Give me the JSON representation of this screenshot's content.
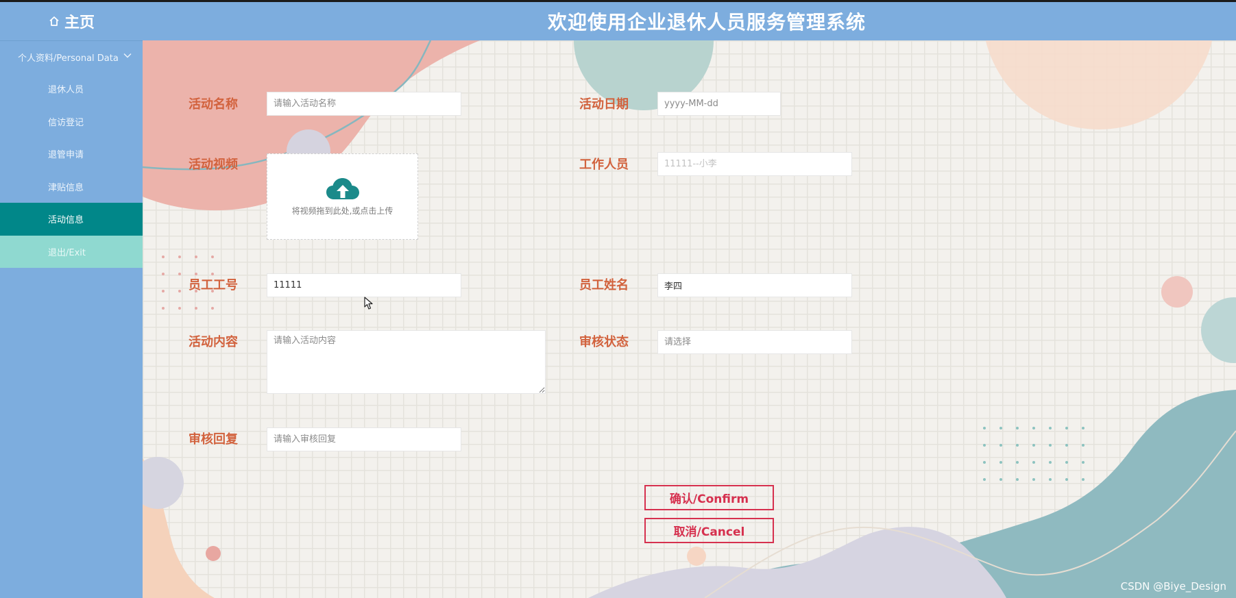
{
  "header": {
    "home_label": "主页",
    "title": "欢迎使用企业退休人员服务管理系统"
  },
  "sidebar": {
    "group_label": "个人资料/Personal Data",
    "items": [
      {
        "label": "退休人员"
      },
      {
        "label": "信访登记"
      },
      {
        "label": "退管申请"
      },
      {
        "label": "津贴信息"
      },
      {
        "label": "活动信息"
      }
    ],
    "exit_label": "退出/Exit",
    "active_item": "活动信息"
  },
  "form": {
    "activity_name": {
      "label": "活动名称",
      "value": "",
      "placeholder": "请输入活动名称"
    },
    "activity_date": {
      "label": "活动日期",
      "value": "",
      "placeholder": "yyyy-MM-dd"
    },
    "activity_video": {
      "label": "活动视频",
      "upload_text": "将视频拖到此处,或点击上传"
    },
    "staff": {
      "label": "工作人员",
      "value": "",
      "placeholder": "11111--小李"
    },
    "employee_id": {
      "label": "员工工号",
      "value": "11111",
      "placeholder": ""
    },
    "employee_name": {
      "label": "员工姓名",
      "value": "李四",
      "placeholder": ""
    },
    "activity_content": {
      "label": "活动内容",
      "value": "",
      "placeholder": "请输入活动内容"
    },
    "review_status": {
      "label": "审核状态",
      "value": "",
      "placeholder": "请选择"
    },
    "review_reply": {
      "label": "审核回复",
      "value": "",
      "placeholder": "请输入审核回复"
    }
  },
  "buttons": {
    "confirm_label": "确认/Confirm",
    "cancel_label": "取消/Cancel"
  },
  "watermark": "CSDN @Biye_Design",
  "colors": {
    "header_bg": "#7dadde",
    "sidebar_active": "#018789",
    "sidebar_exit": "#8fd9d0",
    "label_text": "#d2623d",
    "button_border": "#d6304e",
    "upload_icon": "#1b8a8a"
  }
}
